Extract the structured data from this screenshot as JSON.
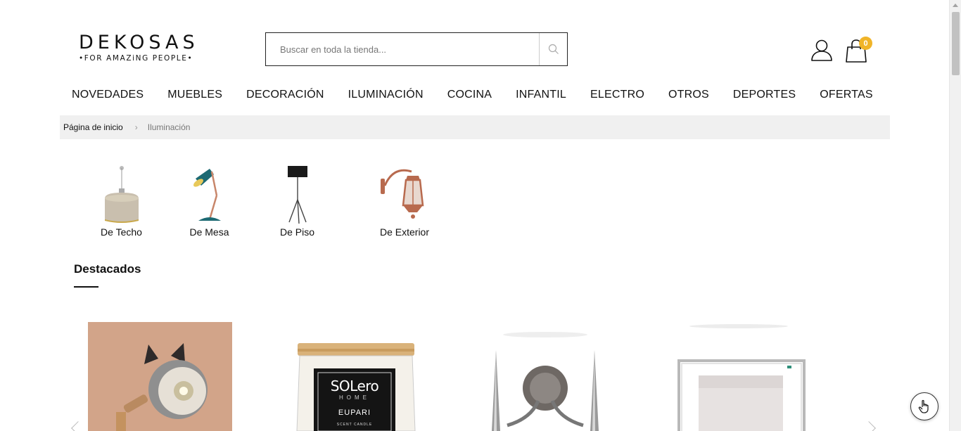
{
  "header": {
    "logo": {
      "brand": "DEKOSAS",
      "tagline": "•FOR AMAZiNG PEOPLE•"
    },
    "search": {
      "placeholder": "Buscar en toda la tienda..."
    },
    "cart": {
      "count": "0"
    }
  },
  "nav": {
    "items": [
      {
        "label": "NOVEDADES"
      },
      {
        "label": "MUEBLES"
      },
      {
        "label": "DECORACIÓN"
      },
      {
        "label": "ILUMINACIÓN"
      },
      {
        "label": "COCINA"
      },
      {
        "label": "INFANTIL"
      },
      {
        "label": "ELECTRO"
      },
      {
        "label": "OTROS"
      },
      {
        "label": "DEPORTES"
      },
      {
        "label": "OFERTAS"
      }
    ]
  },
  "breadcrumb": {
    "home": "Página de inicio",
    "separator": "›",
    "current": "Iluminación"
  },
  "categories": [
    {
      "label": "De Techo",
      "icon": "pendant-lamp-image"
    },
    {
      "label": "De Mesa",
      "icon": "desk-lamp-image"
    },
    {
      "label": "De Piso",
      "icon": "floor-lamp-image"
    },
    {
      "label": "De Exterior",
      "icon": "wall-lantern-image"
    }
  ],
  "featured": {
    "title": "Destacados",
    "products": [
      {
        "image": "cat-ear-lamp-image"
      },
      {
        "image": "solero-candle-image",
        "brand_text": "SOLero",
        "sub_text": "HOME",
        "variant_text": "EUPARI",
        "small_text": "SCENT CANDLE"
      },
      {
        "image": "chrome-wall-sconce-image"
      },
      {
        "image": "square-lamp-image"
      }
    ]
  },
  "colors": {
    "badge": "#f0b428",
    "breadcrumb_bg": "#f0f0f0",
    "text": "#111111"
  }
}
